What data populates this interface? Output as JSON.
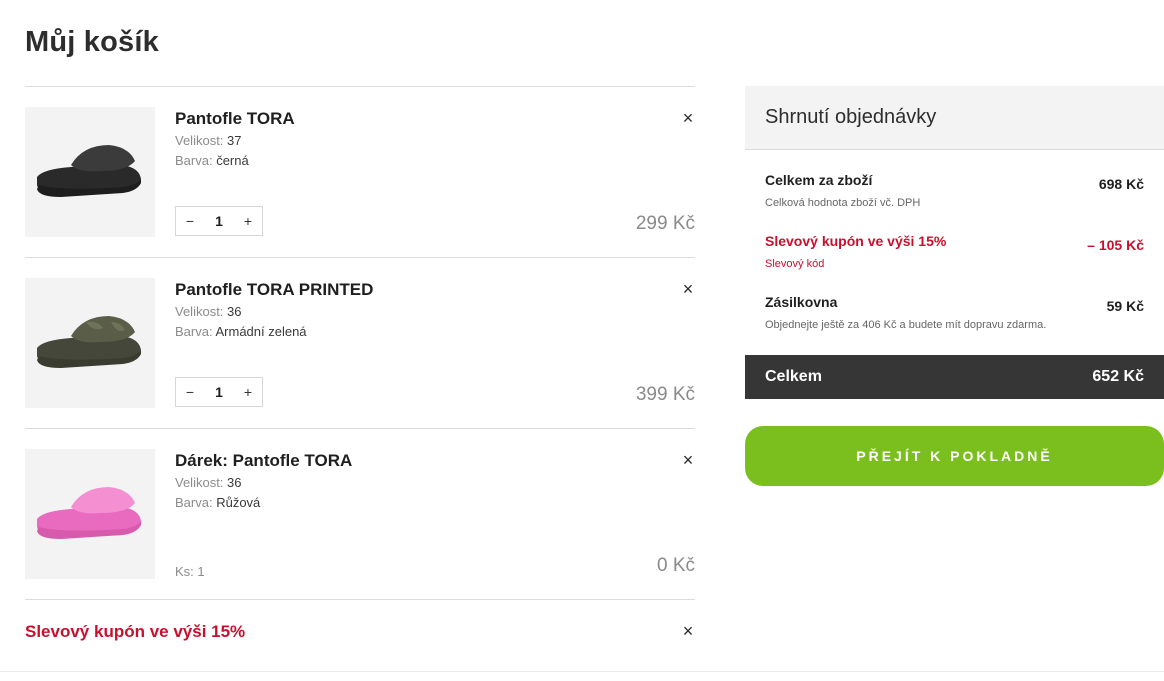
{
  "page": {
    "title": "Můj košík"
  },
  "cart": {
    "items": [
      {
        "name": "Pantofle TORA",
        "size_label": "Velikost:",
        "size": "37",
        "color_label": "Barva:",
        "color": "černá",
        "qty": "1",
        "price": "299 Kč",
        "product_color": "#3b3b3b"
      },
      {
        "name": "Pantofle TORA PRINTED",
        "size_label": "Velikost:",
        "size": "36",
        "color_label": "Barva:",
        "color": "Armádní zelená",
        "qty": "1",
        "price": "399 Kč",
        "product_color": "#5a5e48"
      },
      {
        "name": "Dárek: Pantofle TORA",
        "size_label": "Velikost:",
        "size": "36",
        "color_label": "Barva:",
        "color": "Růžová",
        "qty_label": "Ks: 1",
        "price": "0 Kč",
        "product_color": "#ef7fcb"
      }
    ],
    "coupon": {
      "label": "Slevový kupón ve výši 15%"
    },
    "remove_symbol": "×",
    "minus_symbol": "−",
    "plus_symbol": "+"
  },
  "summary": {
    "title": "Shrnutí objednávky",
    "goods": {
      "label": "Celkem za zboží",
      "sub": "Celková hodnota zboží vč. DPH",
      "amount": "698 Kč"
    },
    "discount": {
      "label": "Slevový kupón ve výši 15%",
      "sub": "Slevový kód",
      "amount": "– 105 Kč"
    },
    "shipping": {
      "label": "Zásilkovna",
      "sub": "Objednejte ještě za 406 Kč a budete mít dopravu zdarma.",
      "amount": "59 Kč"
    },
    "total": {
      "label": "Celkem",
      "amount": "652 Kč"
    }
  },
  "checkout": {
    "label": "PŘEJÍT K POKLADNĚ"
  },
  "colors": {
    "accent_green": "#7bbf1f",
    "discount_red": "#c8102e",
    "total_bar": "#363636"
  }
}
